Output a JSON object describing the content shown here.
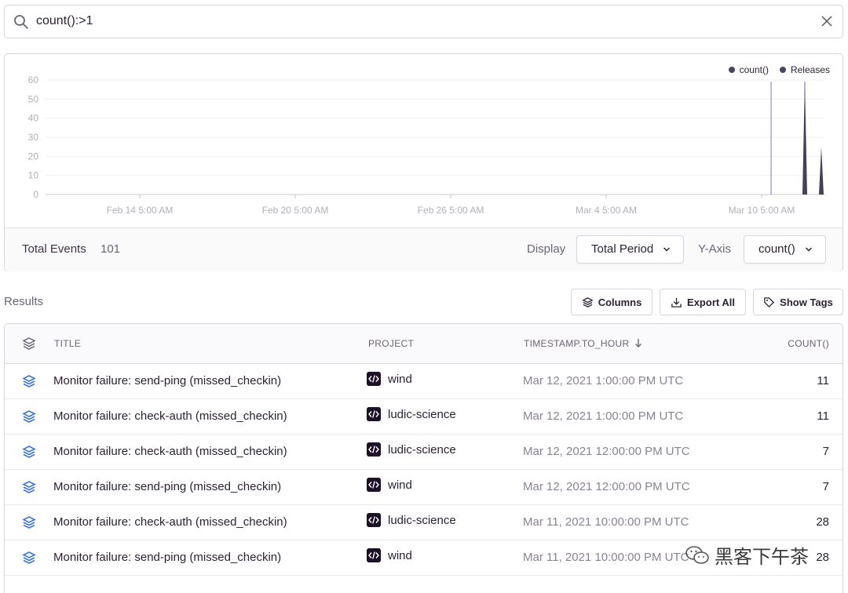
{
  "search": {
    "query": "count():>1"
  },
  "legend": [
    {
      "label": "count()"
    },
    {
      "label": "Releases"
    }
  ],
  "chart_data": {
    "type": "area",
    "title": "",
    "xlabel": "",
    "ylabel": "",
    "x": [
      "Feb 14 5:00 AM",
      "Feb 20 5:00 AM",
      "Feb 26 5:00 AM",
      "Mar 4 5:00 AM",
      "Mar 10 5:00 AM"
    ],
    "y_ticks": [
      0,
      10,
      20,
      30,
      40,
      50,
      60
    ],
    "ylim": [
      0,
      60
    ],
    "series": [
      {
        "name": "count()",
        "values": [
          0,
          0,
          0,
          0,
          0,
          60,
          25
        ]
      }
    ],
    "releases": [
      "Mar 11",
      "Mar 12"
    ],
    "grid": true,
    "legend": "top-right",
    "colors": {
      "series": "#444058",
      "release": "#7b6fd6"
    }
  },
  "footer": {
    "total_label": "Total Events",
    "total_value": "101",
    "display_label": "Display",
    "display_value": "Total Period",
    "yaxis_label": "Y-Axis",
    "yaxis_value": "count()"
  },
  "results": {
    "label": "Results",
    "buttons": {
      "columns": "Columns",
      "export": "Export All",
      "tags": "Show Tags"
    },
    "columns": {
      "title": "TITLE",
      "project": "PROJECT",
      "timestamp": "TIMESTAMP.TO_HOUR",
      "count": "COUNT()"
    },
    "rows": [
      {
        "title": "Monitor failure: send-ping (missed_checkin)",
        "project": "wind",
        "timestamp": "Mar 12, 2021 1:00:00 PM UTC",
        "count": "11"
      },
      {
        "title": "Monitor failure: check-auth (missed_checkin)",
        "project": "ludic-science",
        "timestamp": "Mar 12, 2021 1:00:00 PM UTC",
        "count": "11"
      },
      {
        "title": "Monitor failure: check-auth (missed_checkin)",
        "project": "ludic-science",
        "timestamp": "Mar 12, 2021 12:00:00 PM UTC",
        "count": "7"
      },
      {
        "title": "Monitor failure: send-ping (missed_checkin)",
        "project": "wind",
        "timestamp": "Mar 12, 2021 12:00:00 PM UTC",
        "count": "7"
      },
      {
        "title": "Monitor failure: check-auth (missed_checkin)",
        "project": "ludic-science",
        "timestamp": "Mar 11, 2021 10:00:00 PM UTC",
        "count": "28"
      },
      {
        "title": "Monitor failure: send-ping (missed_checkin)",
        "project": "wind",
        "timestamp": "Mar 11, 2021 10:00:00 PM UTC",
        "count": "28"
      }
    ]
  },
  "watermark": {
    "text": "黑客下午茶"
  },
  "colors": {
    "accent": "#3d74db",
    "text": "#2b2233",
    "muted": "#8a8393"
  }
}
